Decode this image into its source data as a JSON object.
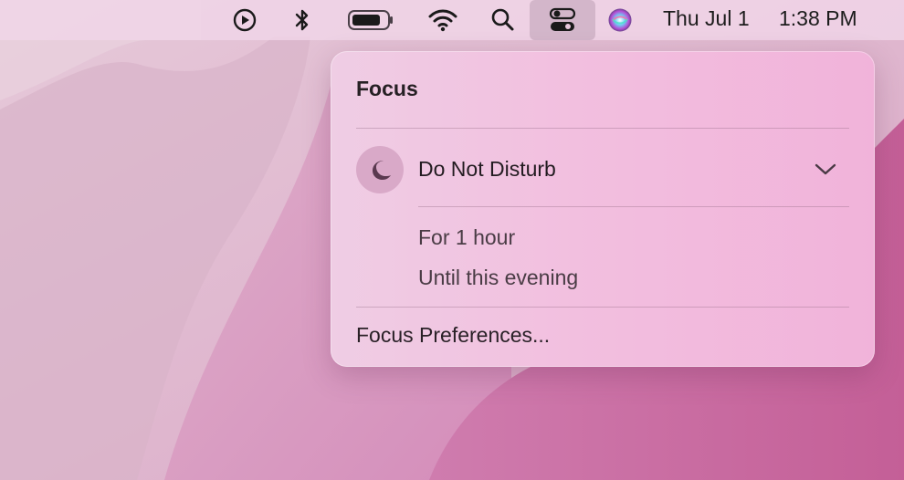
{
  "menubar": {
    "icons": [
      {
        "name": "now-playing-icon"
      },
      {
        "name": "bluetooth-icon"
      },
      {
        "name": "battery-icon"
      },
      {
        "name": "wifi-icon"
      },
      {
        "name": "spotlight-search-icon"
      },
      {
        "name": "control-center-icon"
      },
      {
        "name": "siri-icon"
      }
    ],
    "date": "Thu Jul 1",
    "time": "1:38 PM"
  },
  "focus_panel": {
    "title": "Focus",
    "mode": {
      "label": "Do Not Disturb",
      "icon": "moon-icon"
    },
    "options": [
      {
        "label": "For 1 hour"
      },
      {
        "label": "Until this evening"
      }
    ],
    "preferences_label": "Focus Preferences..."
  },
  "colors": {
    "panel_tint": "#f1bfe0",
    "moon_circle": "#d9a9c8",
    "moon_fill": "#5a3a50"
  }
}
